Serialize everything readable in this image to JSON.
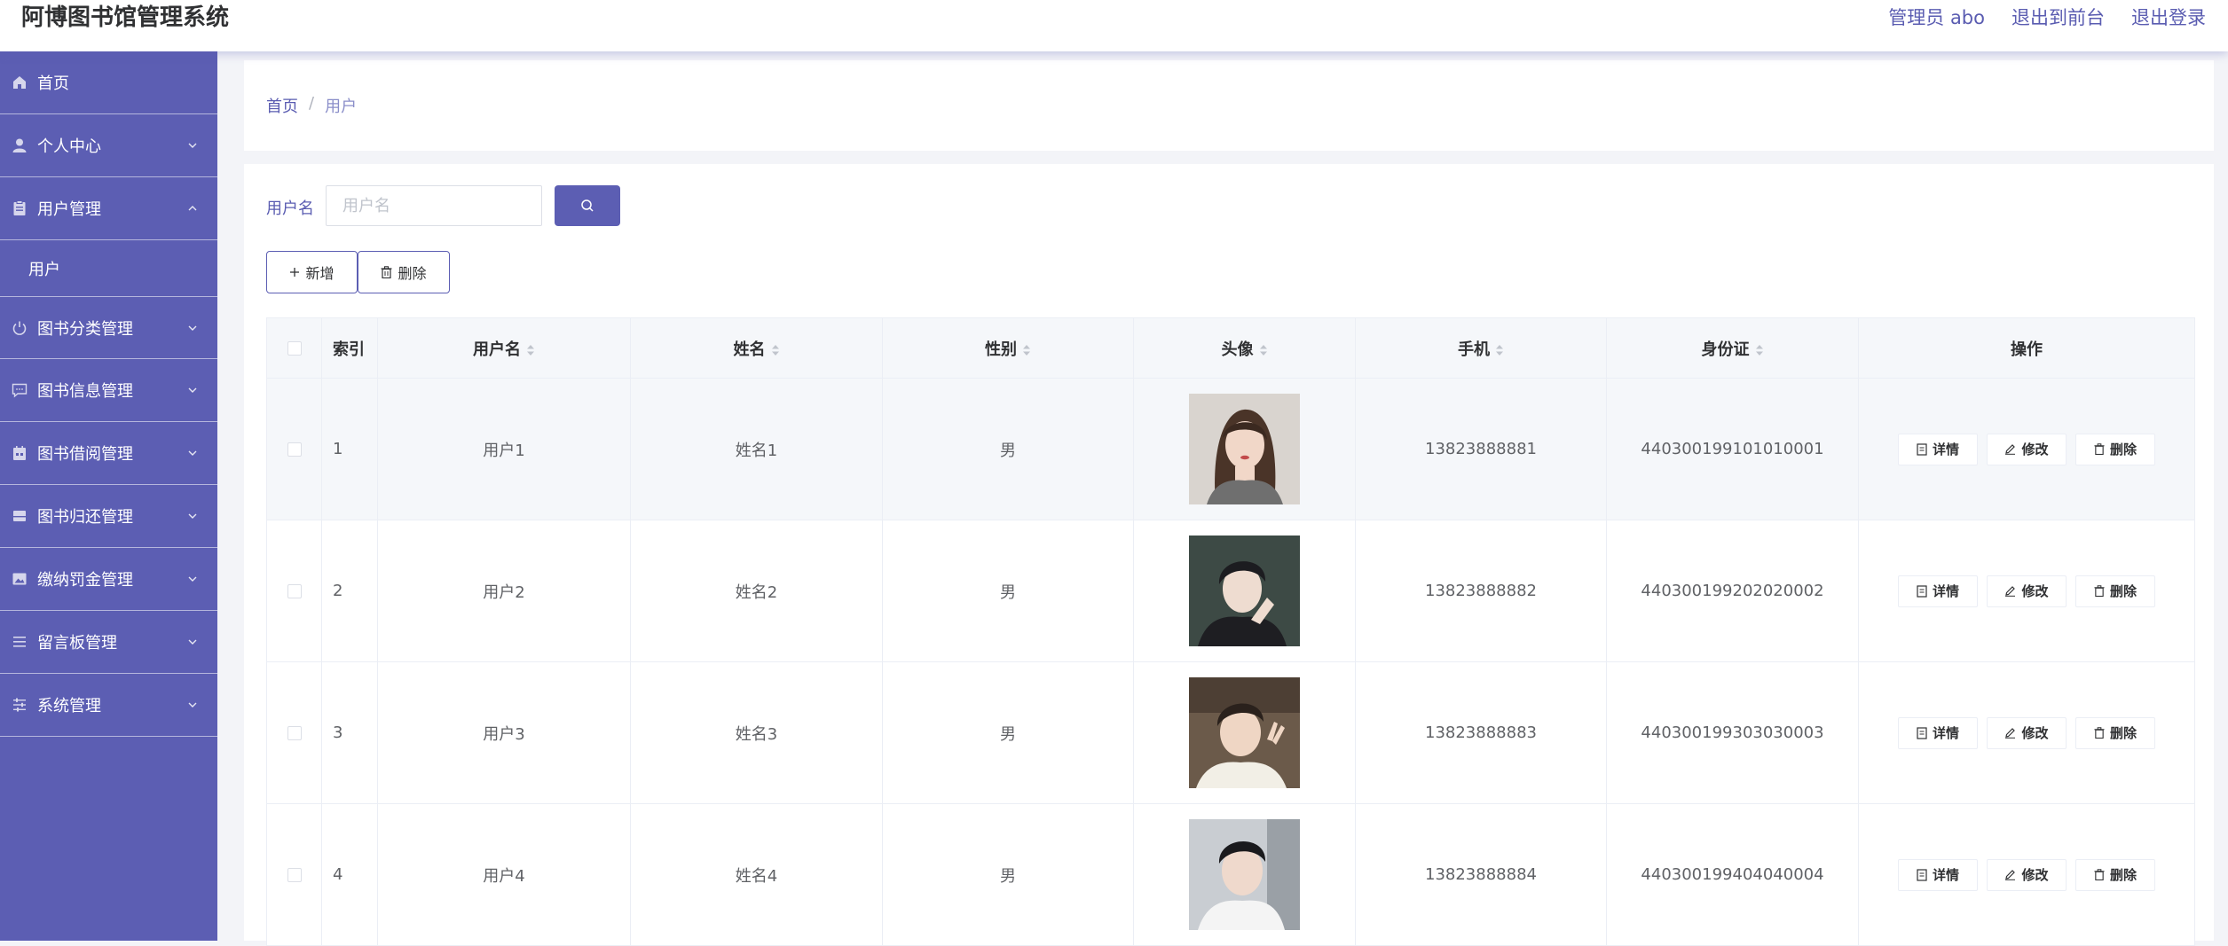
{
  "header": {
    "title": "阿博图书馆管理系统",
    "admin_label": "管理员 abo",
    "exit_front_label": "退出到前台",
    "logout_label": "退出登录"
  },
  "sidebar": {
    "items": [
      {
        "label": "首页",
        "icon": "home-icon"
      },
      {
        "label": "个人中心",
        "icon": "user-icon"
      },
      {
        "label": "用户管理",
        "icon": "clipboard-icon",
        "expanded": true,
        "children": [
          "用户"
        ]
      },
      {
        "label": "图书分类管理",
        "icon": "power-icon"
      },
      {
        "label": "图书信息管理",
        "icon": "message-icon"
      },
      {
        "label": "图书借阅管理",
        "icon": "calendar-icon"
      },
      {
        "label": "图书归还管理",
        "icon": "drawer-icon"
      },
      {
        "label": "缴纳罚金管理",
        "icon": "picture-icon"
      },
      {
        "label": "留言板管理",
        "icon": "list-icon"
      },
      {
        "label": "系统管理",
        "icon": "sliders-icon"
      }
    ]
  },
  "breadcrumb": {
    "home": "首页",
    "separator": "/",
    "current": "用户"
  },
  "search": {
    "label": "用户名",
    "placeholder": "用户名",
    "value": ""
  },
  "actions": {
    "add_label": "新增",
    "delete_label": "删除"
  },
  "table": {
    "columns": [
      "索引",
      "用户名",
      "姓名",
      "性别",
      "头像",
      "手机",
      "身份证",
      "操作"
    ],
    "rows": [
      {
        "index": "1",
        "username": "用户1",
        "name": "姓名1",
        "gender": "男",
        "phone": "13823888881",
        "id_card": "440300199101010001"
      },
      {
        "index": "2",
        "username": "用户2",
        "name": "姓名2",
        "gender": "男",
        "phone": "13823888882",
        "id_card": "440300199202020002"
      },
      {
        "index": "3",
        "username": "用户3",
        "name": "姓名3",
        "gender": "男",
        "phone": "13823888883",
        "id_card": "440300199303030003"
      },
      {
        "index": "4",
        "username": "用户4",
        "name": "姓名4",
        "gender": "男",
        "phone": "13823888884",
        "id_card": "440300199404040004"
      }
    ],
    "row_actions": {
      "detail": "详情",
      "edit": "修改",
      "delete": "删除"
    }
  },
  "colors": {
    "accent": "#5c5eb3",
    "sidebar": "#5c5eb3",
    "link": "#5a5cb1"
  }
}
